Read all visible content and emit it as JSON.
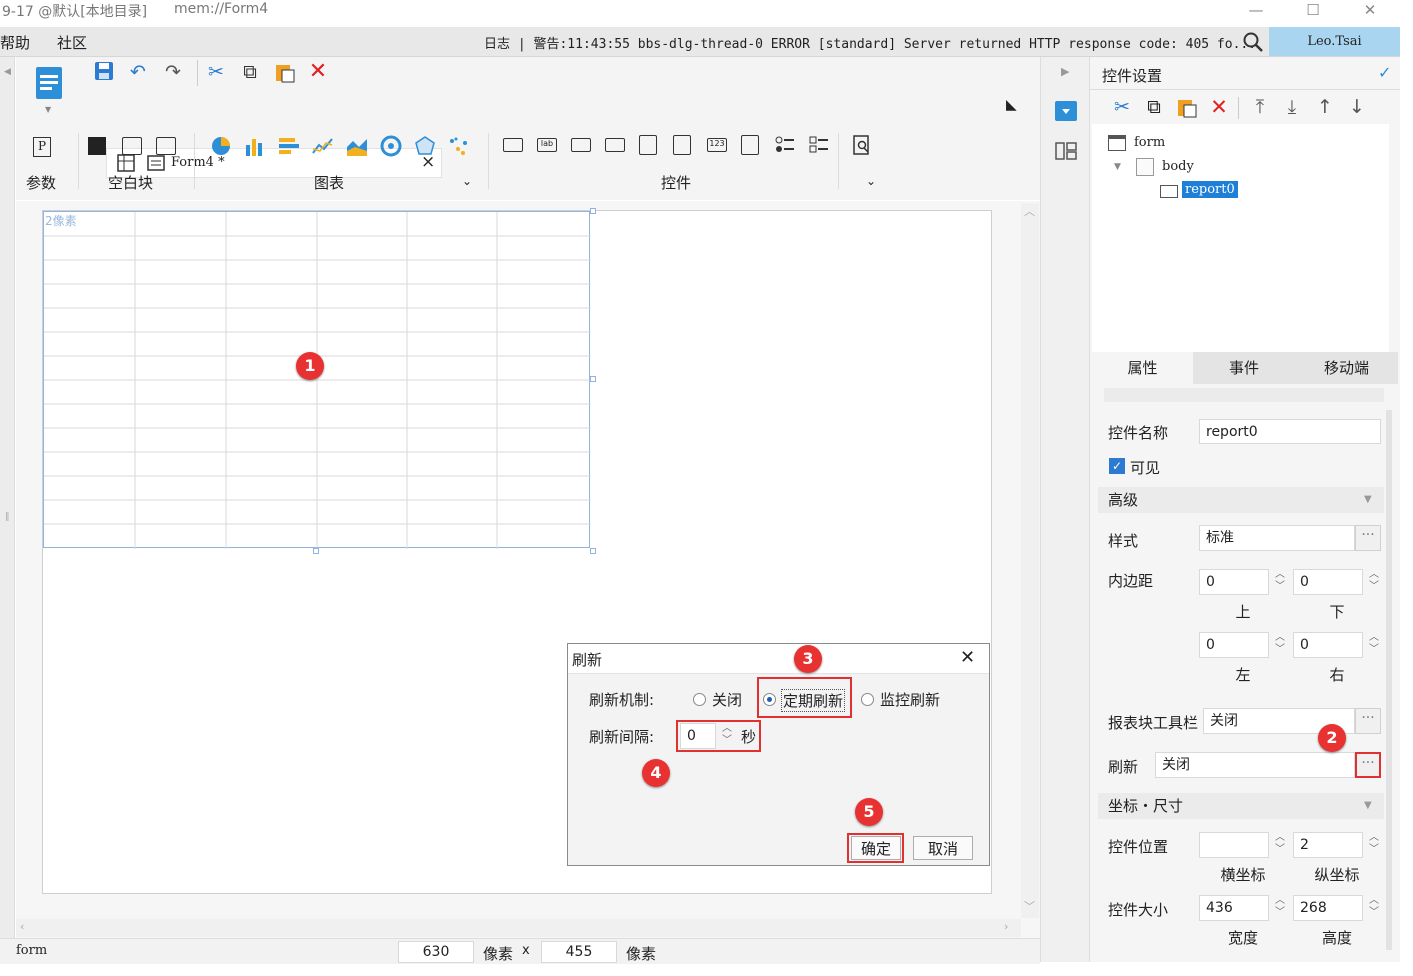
{
  "window": {
    "title_left": "9-17 @默认[本地目录]",
    "title_path": "mem://Form4",
    "minimize": "—",
    "maximize": "☐",
    "close": "✕"
  },
  "menubar": {
    "items": [
      "帮助",
      "社区"
    ],
    "log_text": "日志 | 警告:11:43:55 bbs-dlg-thread-0 ERROR [standard] Server returned HTTP response code: 405 fo...",
    "user": "Leo.Tsai"
  },
  "editor_tab": {
    "title": "Form4 *",
    "close": "×"
  },
  "toolbar_groups": {
    "param": "参数",
    "blank": "空白块",
    "chart": "图表",
    "widget": "控件"
  },
  "canvas": {
    "cell_label": "2像素"
  },
  "status": {
    "label": "form",
    "width": "630",
    "unit1": "像素",
    "times": "x",
    "height": "455",
    "unit2": "像素"
  },
  "right_panel": {
    "title": "控件设置",
    "tree": {
      "root": "form",
      "child": "body",
      "leaf": "report0"
    },
    "tabs": [
      "属性",
      "事件",
      "移动端"
    ],
    "name_label": "控件名称",
    "name_value": "report0",
    "visible_label": "可见",
    "advanced": "高级",
    "style_label": "样式",
    "style_value": "标准",
    "padding_label": "内边距",
    "pad_top": "0",
    "pad_bottom": "0",
    "pad_left": "0",
    "pad_right": "0",
    "lbl_top": "上",
    "lbl_bottom": "下",
    "lbl_left": "左",
    "lbl_right": "右",
    "toolbar_label": "报表块工具栏",
    "toolbar_value": "关闭",
    "refresh_label": "刷新",
    "refresh_value": "关闭",
    "coord_section": "坐标・尺寸",
    "pos_label": "控件位置",
    "pos_x": "",
    "pos_y": "2",
    "lbl_x": "横坐标",
    "lbl_y": "纵坐标",
    "size_label": "控件大小",
    "size_w": "436",
    "size_h": "268",
    "lbl_w": "宽度",
    "lbl_h": "高度"
  },
  "dialog": {
    "title": "刷新",
    "mech_label": "刷新机制:",
    "opt_off": "关闭",
    "opt_periodic": "定期刷新",
    "opt_monitor": "监控刷新",
    "interval_label": "刷新间隔:",
    "interval_value": "0",
    "unit": "秒",
    "ok": "确定",
    "cancel": "取消"
  },
  "badges": [
    "1",
    "2",
    "3",
    "4",
    "5"
  ],
  "colors": {
    "accent": "#1e90ff",
    "highlight_box": "#e03030",
    "badge": "#e83232",
    "selected_node": "#1e7fd8"
  }
}
